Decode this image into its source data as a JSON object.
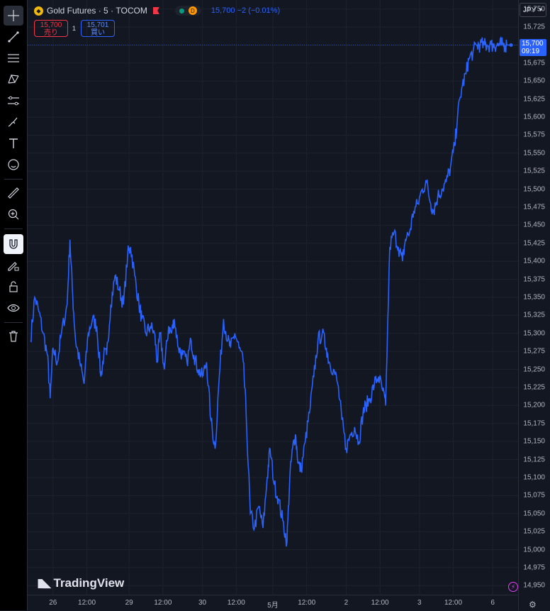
{
  "header": {
    "symbol": "Gold Futures",
    "interval": "5",
    "exchange": "TOCOM",
    "status_label": "D",
    "last_price": "15,700",
    "change": "−2 (−0.01%)"
  },
  "order": {
    "sell_price": "15,700",
    "sell_label": "売り",
    "spread": "1",
    "buy_price": "15,701",
    "buy_label": "買い"
  },
  "currency": "JPY",
  "current_price_label": {
    "price": "15,700",
    "countdown": "09:19"
  },
  "watermark": "TradingView",
  "colors": {
    "line": "#2962ff",
    "background": "#131722",
    "sell": "#f23645",
    "buy": "#2962ff"
  },
  "price_ticks": [
    "15,750",
    "15,725",
    "15,700",
    "15,675",
    "15,650",
    "15,625",
    "15,600",
    "15,575",
    "15,550",
    "15,525",
    "15,500",
    "15,475",
    "15,450",
    "15,425",
    "15,400",
    "15,375",
    "15,350",
    "15,325",
    "15,300",
    "15,275",
    "15,250",
    "15,225",
    "15,200",
    "15,175",
    "15,150",
    "15,125",
    "15,100",
    "15,075",
    "15,050",
    "15,025",
    "15,000",
    "14,975",
    "14,950"
  ],
  "time_ticks": [
    {
      "label": "26",
      "x": 0.8
    },
    {
      "label": "12:00",
      "x": 2.0
    },
    {
      "label": "29",
      "x": 3.5
    },
    {
      "label": "12:00",
      "x": 4.7
    },
    {
      "label": "30",
      "x": 6.1
    },
    {
      "label": "12:00",
      "x": 7.3
    },
    {
      "label": "5月",
      "x": 8.6
    },
    {
      "label": "12:00",
      "x": 9.8
    },
    {
      "label": "2",
      "x": 11.2
    },
    {
      "label": "12:00",
      "x": 12.4
    },
    {
      "label": "3",
      "x": 13.8
    },
    {
      "label": "12:00",
      "x": 15.0
    },
    {
      "label": "6",
      "x": 16.4
    }
  ],
  "tools": [
    "crosshair-icon",
    "trend-line-icon",
    "fib-icon",
    "pattern-icon",
    "forecast-icon",
    "brush-icon",
    "text-icon",
    "emoji-icon",
    "ruler-icon",
    "zoom-in-icon",
    "magnet-icon",
    "lock-draw-icon",
    "lock-icon",
    "eye-icon",
    "trash-icon"
  ],
  "chart_data": {
    "type": "line",
    "ylim": [
      14937.5,
      15762.5
    ],
    "xlim": [
      0,
      17.15
    ],
    "x": [
      0.0,
      0.15,
      0.3,
      0.45,
      0.6,
      0.7,
      0.8,
      0.95,
      1.1,
      1.3,
      1.4,
      1.5,
      1.6,
      1.75,
      1.9,
      2.05,
      2.2,
      2.35,
      2.5,
      2.6,
      2.7,
      2.85,
      3.0,
      3.15,
      3.3,
      3.45,
      3.55,
      3.7,
      3.85,
      3.95,
      4.1,
      4.25,
      4.4,
      4.5,
      4.6,
      4.75,
      4.9,
      5.0,
      5.1,
      5.25,
      5.4,
      5.55,
      5.7,
      5.8,
      5.95,
      6.1,
      6.25,
      6.4,
      6.55,
      6.7,
      6.85,
      7.0,
      7.1,
      7.25,
      7.4,
      7.55,
      7.65,
      7.8,
      7.95,
      8.1,
      8.25,
      8.4,
      8.5,
      8.65,
      8.8,
      8.95,
      9.1,
      9.2,
      9.3,
      9.4,
      9.5,
      9.6,
      9.75,
      9.9,
      10.05,
      10.2,
      10.35,
      10.5,
      10.6,
      10.75,
      10.9,
      11.05,
      11.2,
      11.35,
      11.5,
      11.65,
      11.8,
      11.9,
      12.05,
      12.2,
      12.35,
      12.5,
      12.6,
      12.75,
      12.9,
      13.05,
      13.2,
      13.3,
      13.45,
      13.6,
      13.75,
      13.9,
      14.05,
      14.2,
      14.3,
      14.45,
      14.6,
      14.75,
      14.9,
      15.05,
      15.15,
      15.3,
      15.45,
      15.55,
      15.7,
      15.85,
      15.95,
      16.1,
      16.2,
      16.35,
      16.45,
      16.55,
      16.65,
      16.75,
      16.85,
      16.95,
      17.0,
      17.05
    ],
    "y": [
      15290,
      15350,
      15330,
      15300,
      15270,
      15210,
      15280,
      15260,
      15300,
      15340,
      15430,
      15350,
      15290,
      15260,
      15230,
      15300,
      15320,
      15310,
      15240,
      15270,
      15270,
      15340,
      15380,
      15360,
      15340,
      15410,
      15420,
      15380,
      15340,
      15320,
      15300,
      15310,
      15300,
      15260,
      15300,
      15250,
      15310,
      15300,
      15320,
      15280,
      15270,
      15260,
      15290,
      15270,
      15250,
      15240,
      15260,
      15180,
      15140,
      15240,
      15320,
      15290,
      15280,
      15300,
      15280,
      15260,
      15190,
      15050,
      15030,
      15060,
      15030,
      15100,
      15140,
      15090,
      15070,
      15040,
      15010,
      15100,
      15140,
      15160,
      15120,
      15110,
      15150,
      15190,
      15240,
      15290,
      15300,
      15280,
      15260,
      15250,
      15230,
      15180,
      15140,
      15160,
      15170,
      15150,
      15190,
      15200,
      15210,
      15230,
      15240,
      15220,
      15200,
      15420,
      15440,
      15420,
      15400,
      15430,
      15440,
      15470,
      15480,
      15500,
      15510,
      15480,
      15470,
      15490,
      15500,
      15510,
      15530,
      15560,
      15600,
      15640,
      15660,
      15680,
      15690,
      15700,
      15700,
      15700,
      15700,
      15700,
      15700,
      15700,
      15700,
      15700,
      15700,
      15700,
      15700,
      15700
    ]
  }
}
